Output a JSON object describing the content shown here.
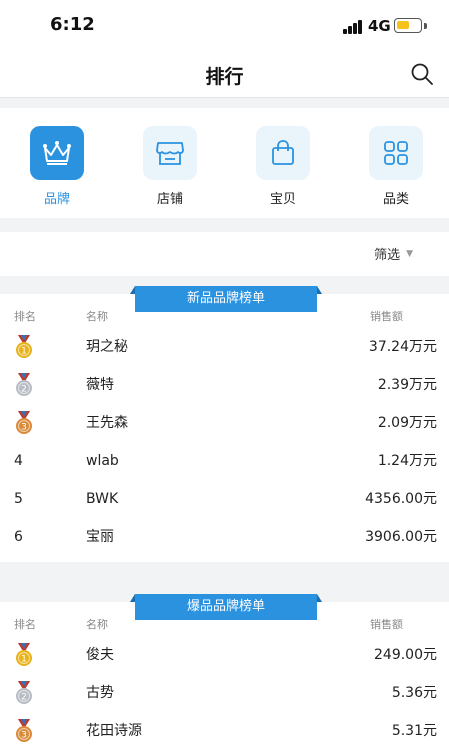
{
  "status_bar": {
    "time": "6:12",
    "network": "4G"
  },
  "header": {
    "title": "排行"
  },
  "tabs": [
    {
      "label": "品牌",
      "icon": "crown-icon",
      "active": true
    },
    {
      "label": "店铺",
      "icon": "store-icon",
      "active": false
    },
    {
      "label": "宝贝",
      "icon": "bag-icon",
      "active": false
    },
    {
      "label": "品类",
      "icon": "grid-icon",
      "active": false
    }
  ],
  "filter": {
    "label": "筛选"
  },
  "rankings": [
    {
      "title": "新品品牌榜单",
      "headers": {
        "rank": "排名",
        "name": "名称",
        "amount": "销售额"
      },
      "rows": [
        {
          "rank": "1",
          "name": "玥之秘",
          "amount": "37.24万元"
        },
        {
          "rank": "2",
          "name": "薇特",
          "amount": "2.39万元"
        },
        {
          "rank": "3",
          "name": "王先森",
          "amount": "2.09万元"
        },
        {
          "rank": "4",
          "name": "wlab",
          "amount": "1.24万元"
        },
        {
          "rank": "5",
          "name": "BWK",
          "amount": "4356.00元"
        },
        {
          "rank": "6",
          "name": "宝丽",
          "amount": "3906.00元"
        }
      ]
    },
    {
      "title": "爆品品牌榜单",
      "headers": {
        "rank": "排名",
        "name": "名称",
        "amount": "销售额"
      },
      "rows": [
        {
          "rank": "1",
          "name": "俊夫",
          "amount": "249.00元"
        },
        {
          "rank": "2",
          "name": "古势",
          "amount": "5.36元"
        },
        {
          "rank": "3",
          "name": "花田诗源",
          "amount": "5.31元"
        }
      ]
    }
  ],
  "colors": {
    "accent": "#2b92e0",
    "gold": "#e8b21c",
    "silver": "#b8bcc4",
    "bronze": "#d98a3a",
    "battery": "#f6c21c"
  }
}
